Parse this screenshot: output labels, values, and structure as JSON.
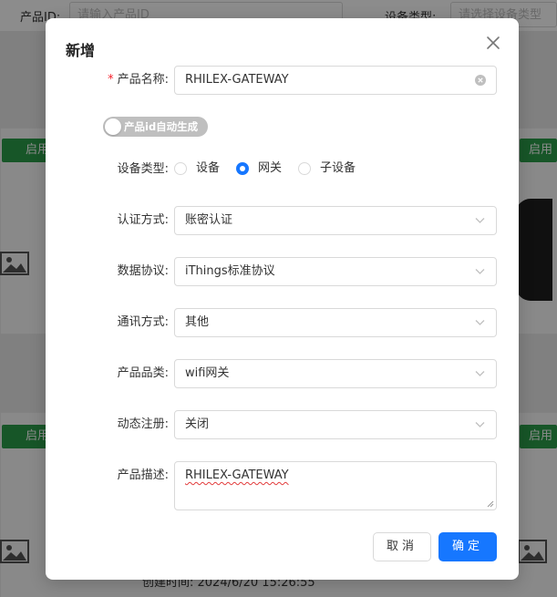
{
  "background": {
    "filter": {
      "product_id_label": "产品ID:",
      "product_id_placeholder": "请输入产品ID",
      "device_type_label": "设备类型:",
      "device_type_placeholder": "请选择设备类型"
    },
    "enable_label": "启用",
    "created_time_text": "创建时间:   2024/6/20 15:26:55"
  },
  "modal": {
    "title": "新增",
    "fields": {
      "product_name": {
        "label": "产品名称:",
        "required_mark": "*",
        "value": "RHILEX-GATEWAY"
      },
      "auto_id_switch": {
        "label": "产品id自动生成",
        "checked": false
      },
      "device_type": {
        "label": "设备类型:",
        "options": [
          "设备",
          "网关",
          "子设备"
        ],
        "selected": "网关"
      },
      "auth_method": {
        "label": "认证方式:",
        "value": "账密认证"
      },
      "data_protocol": {
        "label": "数据协议:",
        "value": "iThings标准协议"
      },
      "comm_method": {
        "label": "通讯方式:",
        "value": "其他"
      },
      "product_category": {
        "label": "产品品类:",
        "value": "wifi网关"
      },
      "dynamic_register": {
        "label": "动态注册:",
        "value": "关闭"
      },
      "description": {
        "label": "产品描述:",
        "value": "RHILEX-GATEWAY"
      }
    },
    "buttons": {
      "cancel": "取消",
      "ok": "确定"
    }
  },
  "colors": {
    "primary": "#1677ff",
    "enable_green": "#2a9d4a",
    "required_red": "#f5222d",
    "switch_off": "#bfbfbf"
  }
}
